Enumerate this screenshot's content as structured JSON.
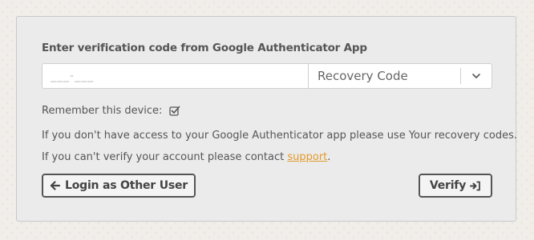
{
  "form": {
    "title": "Enter verification code from Google Authenticator App",
    "code_placeholder": "___-___",
    "code_value": "",
    "code_type_selected": "Recovery Code",
    "remember_label": "Remember this device:",
    "remember_checked": true,
    "info_line1": "If you don't have access to your Google Authenticator app please use Your recovery codes.",
    "info_line2_prefix": "If you can't verify your account please contact ",
    "support_link": "support",
    "info_line2_suffix": "."
  },
  "buttons": {
    "login_other_label": "Login as Other User",
    "verify_label": "Verify"
  },
  "icons": {
    "login_other": "arrow-left-icon",
    "verify": "sign-in-icon",
    "select": "chevron-down-icon",
    "remember": "checkbox-checked-icon"
  },
  "colors": {
    "link": "#e39a2b",
    "panel_background": "#ebebeb",
    "button_border": "#555555"
  }
}
